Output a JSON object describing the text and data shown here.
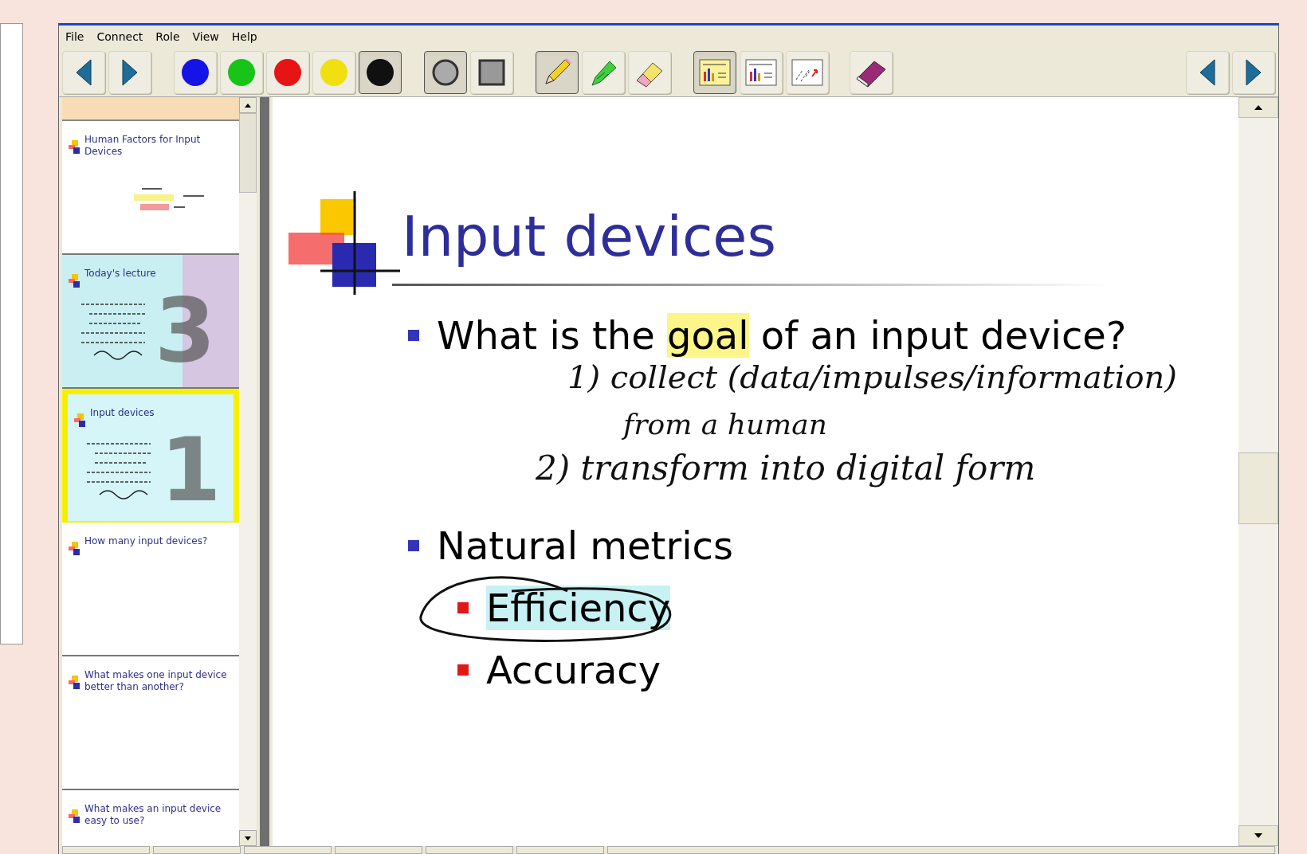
{
  "menu": [
    {
      "label": "File"
    },
    {
      "label": "Connect"
    },
    {
      "label": "Role"
    },
    {
      "label": "View"
    },
    {
      "label": "Help"
    }
  ],
  "toolbar": {
    "groups": [
      [
        {
          "kind": "back",
          "selected": false
        },
        {
          "kind": "forward",
          "selected": false
        }
      ],
      [
        {
          "kind": "color",
          "color": "#1414e6",
          "selected": false
        },
        {
          "kind": "color",
          "color": "#18c418",
          "selected": false
        },
        {
          "kind": "color",
          "color": "#e61414",
          "selected": false
        },
        {
          "kind": "color",
          "color": "#f0e010",
          "selected": false
        },
        {
          "kind": "color",
          "color": "#101010",
          "selected": true
        }
      ],
      [
        {
          "kind": "round-tip",
          "selected": true
        },
        {
          "kind": "square-tip",
          "selected": false
        }
      ],
      [
        {
          "kind": "pencil",
          "selected": true
        },
        {
          "kind": "highlighter",
          "selected": false
        },
        {
          "kind": "eraser",
          "selected": false
        }
      ],
      [
        {
          "kind": "view-notes",
          "selected": true
        },
        {
          "kind": "view-slide",
          "selected": false
        },
        {
          "kind": "view-ink",
          "selected": false
        }
      ],
      [
        {
          "kind": "clear",
          "selected": false
        }
      ]
    ],
    "right": [
      {
        "kind": "back",
        "selected": false
      },
      {
        "kind": "forward",
        "selected": false
      }
    ]
  },
  "thumbnails": [
    {
      "kind": "partial",
      "selected": false
    },
    {
      "kind": "white",
      "title": "Human Factors for Input Devices",
      "selected": false
    },
    {
      "kind": "split",
      "title": "Today's lecture",
      "number": "3",
      "selected": false
    },
    {
      "kind": "cyan",
      "title": "Input devices",
      "number": "1",
      "selected": true
    },
    {
      "kind": "white",
      "title": "How many input devices?",
      "selected": false
    },
    {
      "kind": "white",
      "title": "What makes one input device better than another?",
      "selected": false
    },
    {
      "kind": "white",
      "title": "What makes an input device easy to use?",
      "selected": false
    }
  ],
  "slide": {
    "title": "Input devices",
    "bullets": [
      {
        "parts": [
          {
            "kind": "plain",
            "text": "What is the "
          },
          {
            "kind": "highlight",
            "text": "goal",
            "color": "#fbf58a"
          },
          {
            "kind": "plain",
            "text": " of an input device?"
          }
        ]
      },
      {
        "parts": [
          {
            "kind": "plain",
            "text": "Natural metrics"
          }
        ],
        "children": [
          {
            "parts": [
              {
                "kind": "highlight",
                "text": "Efficiency",
                "color": "#c8f1f4"
              }
            ]
          },
          {
            "parts": [
              {
                "kind": "plain",
                "text": "Accuracy"
              }
            ]
          }
        ]
      }
    ],
    "ink": [
      {
        "kind": "text",
        "text": "1) collect (data/impulses/information)"
      },
      {
        "kind": "text",
        "text": "from a human"
      },
      {
        "kind": "text",
        "text": "2) transform into digital form"
      },
      {
        "kind": "loop"
      }
    ]
  }
}
